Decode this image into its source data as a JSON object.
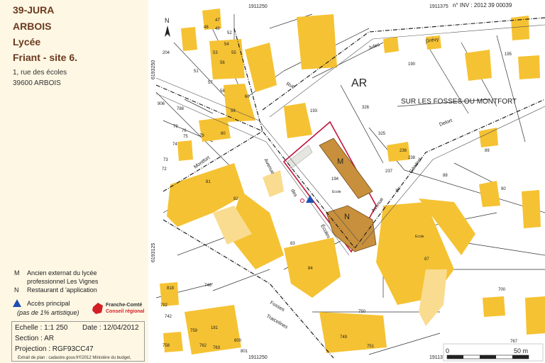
{
  "header": {
    "dept": "39-JURA",
    "town": "ARBOIS",
    "type": "Lycée",
    "name": "Friant - site 6.",
    "street": "1, rue des écoles",
    "postcode_city": "39600 ARBOIS"
  },
  "legend": {
    "m_key": "M",
    "m_text1": "Ancien externat du lycée",
    "m_text2": "professionnel Les Vignes",
    "n_key": "N",
    "n_text": "Restaurant d 'application",
    "access_label": "Accès principal",
    "access_note": "(pas de 1% artistique)",
    "logo_line1": "Franche-Comté",
    "logo_line2": "Conseil régional"
  },
  "info": {
    "scale": "Echelle : 1:1 250",
    "date": "Date : 12/04/2012",
    "section": "Section : AR",
    "projection": "Projection : RGF93CC47",
    "credit": "Extrait de plan : cadastre.gouv.fr©2012 Ministère du budget,"
  },
  "map": {
    "inv": "n° INV : 2012 39 00039",
    "coord_top_left": "1911250",
    "coord_top_right": "1911375",
    "coord_bottom_left": "1911250",
    "coord_bottom_right": "1911375",
    "coord_left_top": "6193250",
    "coord_left_bottom": "6193125",
    "section_label": "AR",
    "lieu_dit": "SUR LES FOSSES OU MONTFORT",
    "north": "N",
    "scalebar_start": "0",
    "scalebar_end": "50 m",
    "building_m": "M",
    "building_n": "N",
    "street_avenue": "Avenue",
    "street_des": "des",
    "street_ecoles": "Écoles",
    "street_rue": "Rue",
    "street_montfort": "Montfort",
    "street_fosses": "Fosses",
    "street_traicelines": "Traicelines",
    "street_grevy": "Grévy",
    "street_jules": "Jules",
    "street_avenue2": "Avenue",
    "street_du": "du",
    "street_general": "Général",
    "street_delort": "Delort",
    "ecole1": "Ecole",
    "ecole2": "Ecole",
    "parcels": [
      "47",
      "48",
      "49",
      "52",
      "53",
      "54",
      "55",
      "56",
      "57",
      "58",
      "59",
      "60",
      "51",
      "204",
      "906",
      "788",
      "78",
      "76",
      "75",
      "79",
      "80",
      "74",
      "73",
      "72",
      "81",
      "82",
      "83",
      "84",
      "193",
      "194",
      "325",
      "326",
      "190",
      "195",
      "237",
      "236",
      "238",
      "88",
      "89",
      "90",
      "87",
      "746",
      "818",
      "792",
      "742",
      "181",
      "750",
      "749",
      "751",
      "758",
      "759",
      "762",
      "763",
      "800",
      "801",
      "700",
      "767"
    ]
  },
  "colors": {
    "building": "#f5c233",
    "building_light": "#f9dc8f",
    "school_building": "#c8903c",
    "site_outline": "#c0143c",
    "access": "#1f4fb0",
    "title": "#6b3a1e"
  }
}
